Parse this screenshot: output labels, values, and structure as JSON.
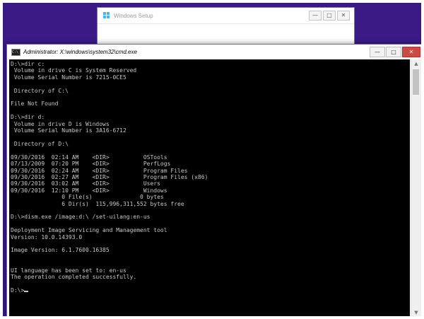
{
  "setup_window": {
    "title": "Windows Setup",
    "controls": {
      "minimize": "—",
      "maximize": "□",
      "close": "✕"
    }
  },
  "cmd_window": {
    "title": "Administrator: X:\\windows\\system32\\cmd.exe",
    "icon_text": "C:\\",
    "controls": {
      "minimize": "—",
      "maximize": "□",
      "close": "✕"
    }
  },
  "console": {
    "lines": [
      "D:\\>dir c:",
      " Volume in drive C is System Reserved",
      " Volume Serial Number is 7215-0CE5",
      "",
      " Directory of C:\\",
      "",
      "File Not Found",
      "",
      "D:\\>dir d:",
      " Volume in drive D is Windows",
      " Volume Serial Number is 3A16-6712",
      "",
      " Directory of D:\\",
      "",
      "09/30/2016  02:14 AM    <DIR>          OSTools",
      "07/13/2009  07:20 PM    <DIR>          PerfLogs",
      "09/30/2016  02:24 AM    <DIR>          Program Files",
      "09/30/2016  02:27 AM    <DIR>          Program Files (x86)",
      "09/30/2016  03:02 AM    <DIR>          Users",
      "09/30/2016  12:10 PM    <DIR>          Windows",
      "               0 File(s)              0 bytes",
      "               6 Dir(s)  115,996,311,552 bytes free",
      "",
      "D:\\>dism.exe /image:d:\\ /set-uilang:en-us",
      "",
      "Deployment Image Servicing and Management tool",
      "Version: 10.0.14393.0",
      "",
      "Image Version: 6.1.7600.16385",
      "",
      "",
      "UI language has been set to: en-us",
      "The operation completed successfully.",
      ""
    ],
    "prompt": "D:\\>"
  },
  "scrollbar": {
    "up": "▲",
    "down": "▼"
  },
  "colors": {
    "desktop": "#3b1a86",
    "console_bg": "#000000",
    "console_fg": "#c8c8c8",
    "close_button": "#c94b43"
  }
}
